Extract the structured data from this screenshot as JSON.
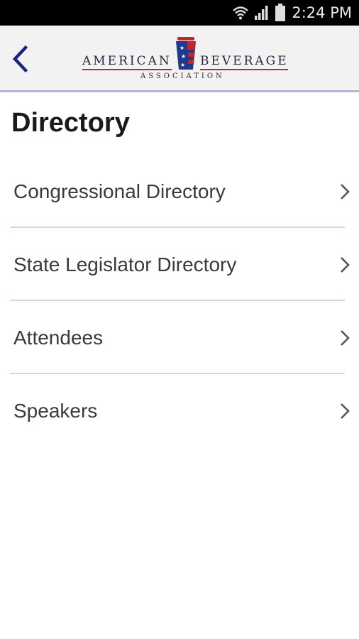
{
  "status_bar": {
    "time": "2:24 PM"
  },
  "header": {
    "logo": {
      "word_left": "AMERICAN",
      "word_right": "BEVERAGE",
      "subtitle": "ASSOCIATION"
    },
    "accent_color": "#1a237e"
  },
  "page": {
    "title": "Directory"
  },
  "directory": {
    "items": [
      {
        "label": "Congressional Directory"
      },
      {
        "label": "State Legislator Directory"
      },
      {
        "label": "Attendees"
      },
      {
        "label": "Speakers"
      }
    ]
  }
}
